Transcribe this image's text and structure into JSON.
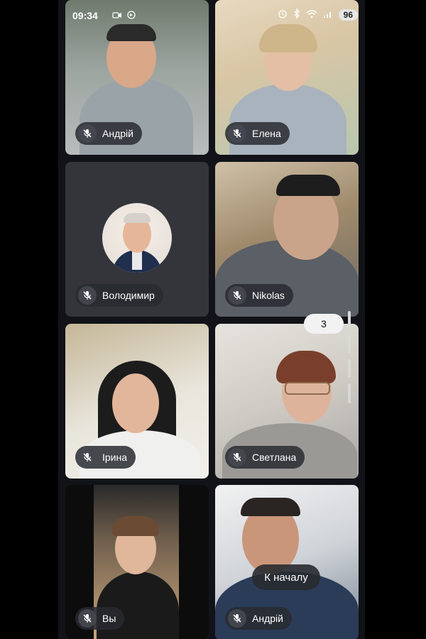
{
  "status_bar": {
    "time": "09:34",
    "battery": "96"
  },
  "tiles": [
    {
      "name": "Андрій"
    },
    {
      "name": "Елена"
    },
    {
      "name": "Володимир"
    },
    {
      "name": "Nikolas"
    },
    {
      "name": "Ірина"
    },
    {
      "name": "Светлана"
    },
    {
      "name": "Вы"
    },
    {
      "name": "Андрій"
    }
  ],
  "pager": {
    "page": "3"
  },
  "toast": {
    "label": "К началу"
  },
  "icons": {
    "mic_muted": "mic-off-icon",
    "camera": "camera-icon",
    "cast": "cast-icon",
    "alarm": "alarm-icon",
    "bluetooth": "bluetooth-icon",
    "wifi": "wifi-icon",
    "signal": "signal-icon"
  }
}
